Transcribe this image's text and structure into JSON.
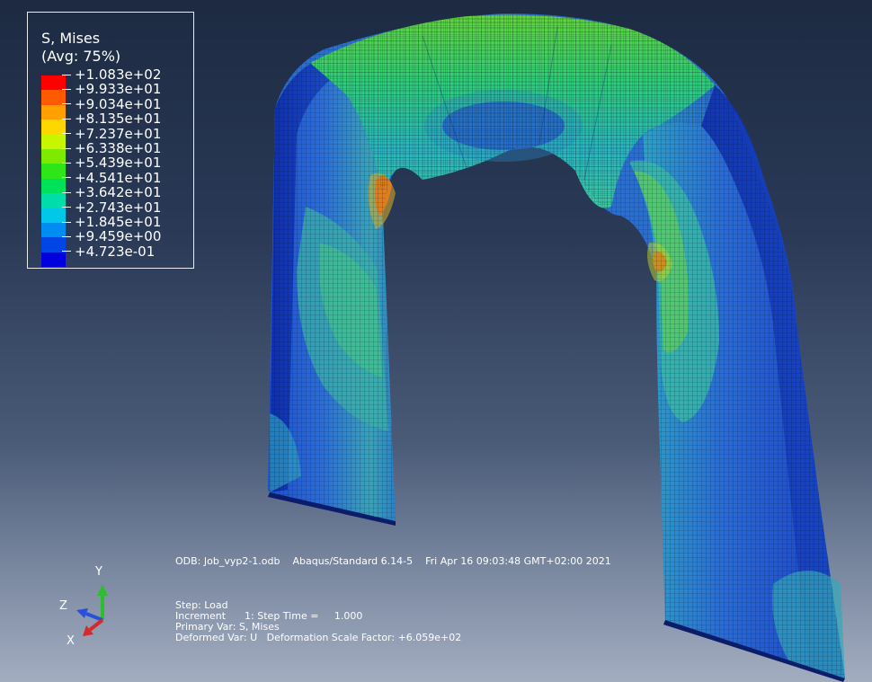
{
  "legend": {
    "title": "S, Mises",
    "subtitle": "(Avg: 75%)",
    "values": [
      "+1.083e+02",
      "+9.933e+01",
      "+9.034e+01",
      "+8.135e+01",
      "+7.237e+01",
      "+6.338e+01",
      "+5.439e+01",
      "+4.541e+01",
      "+3.642e+01",
      "+2.743e+01",
      "+1.845e+01",
      "+9.459e+00",
      "+4.723e-01"
    ],
    "colors": [
      "#ff0000",
      "#ff5a00",
      "#ffa000",
      "#ffd700",
      "#c8f500",
      "#7dea00",
      "#2ee51a",
      "#00e15a",
      "#00dcaa",
      "#00c8e6",
      "#008cf0",
      "#0046e6",
      "#0000dd"
    ]
  },
  "info": {
    "odb": "ODB: Job_vyp2-1.odb    Abaqus/Standard 6.14-5    Fri Apr 16 09:03:48 GMT+02:00 2021",
    "step": "Step: Load",
    "increment": "Increment      1: Step Time =     1.000",
    "primary_var": "Primary Var: S, Mises",
    "deformed_var": "Deformed Var: U   Deformation Scale Factor: +6.059e+02"
  },
  "triad": {
    "y_label": "Y",
    "z_label": "Z",
    "x_label": "X",
    "y_color": "#2ebd2e",
    "z_color": "#2a4fd8",
    "x_color": "#d42a2a"
  }
}
